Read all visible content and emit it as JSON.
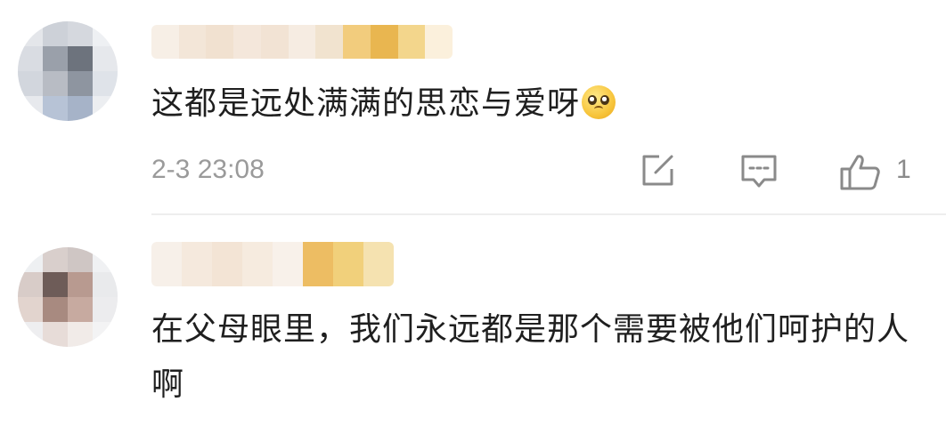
{
  "comments": [
    {
      "text": "这都是远处满满的思恋与爱呀",
      "emoji": "pleading-face-emoji",
      "timestamp": "2-3 23:08",
      "like_count": "1"
    },
    {
      "text": "在父母眼里，我们永远都是那个需要被他们呵护的人啊"
    }
  ],
  "icons": {
    "share": "edit-share-icon",
    "reply": "comment-reply-icon",
    "like": "thumbs-up-icon"
  },
  "colors": {
    "text": "#1f1f1f",
    "meta": "#9a9a9a",
    "icon": "#8a8a8a",
    "divider": "#eeeeee"
  }
}
